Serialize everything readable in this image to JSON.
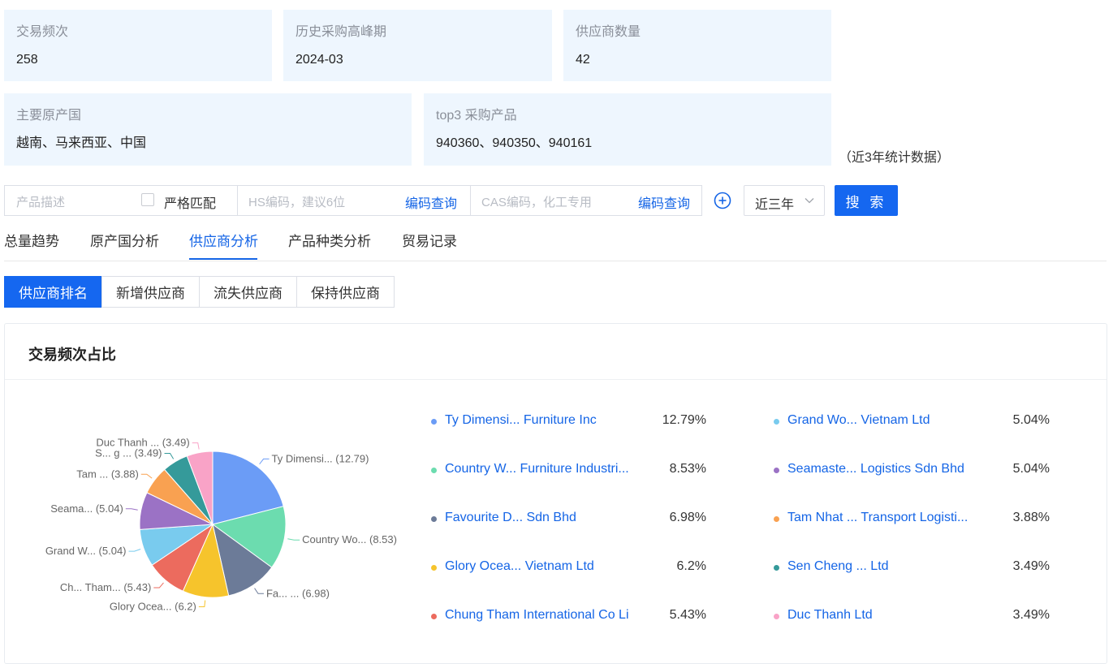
{
  "stats": [
    {
      "label": "交易频次",
      "value": "258"
    },
    {
      "label": "历史采购高峰期",
      "value": "2024-03"
    },
    {
      "label": "供应商数量",
      "value": "42"
    },
    {
      "label": "主要原产国",
      "value": "越南、马来西亚、中国"
    },
    {
      "label": "top3 采购产品",
      "value": "940360、940350、940161"
    }
  ],
  "stats_note": "（近3年统计数据）",
  "search": {
    "product_placeholder": "产品描述",
    "strict_label": "严格匹配",
    "hs_placeholder": "HS编码，建议6位",
    "hs_link": "编码查询",
    "cas_placeholder": "CAS编码，化工专用",
    "cas_link": "编码查询",
    "range_value": "近三年",
    "search_button": "搜 索"
  },
  "tabs": [
    "总量趋势",
    "原产国分析",
    "供应商分析",
    "产品种类分析",
    "贸易记录"
  ],
  "active_tab": 2,
  "subtabs": [
    "供应商排名",
    "新增供应商",
    "流失供应商",
    "保持供应商"
  ],
  "active_subtab": 0,
  "panel_title": "交易频次占比",
  "chart_data": {
    "type": "pie",
    "title": "交易频次占比",
    "slices": [
      {
        "name": "Ty Dimensi... Furniture Inc",
        "label": "Ty Dimensi... (12.79)",
        "value": 12.79,
        "color": "#6b9cf6",
        "pct": "12.79%"
      },
      {
        "name": "Country W... Furniture Industri...",
        "label": "Country Wo... (8.53)",
        "value": 8.53,
        "color": "#6cdcaf",
        "pct": "8.53%"
      },
      {
        "name": "Favourite D... Sdn Bhd",
        "label": "Fa... ... (6.98)",
        "value": 6.98,
        "color": "#6c7b98",
        "pct": "6.98%"
      },
      {
        "name": "Glory Ocea... Vietnam Ltd",
        "label": "Glory Ocea... (6.2)",
        "value": 6.2,
        "color": "#f6c42c",
        "pct": "6.2%"
      },
      {
        "name": "Chung Tham International Co Li",
        "label": "Ch... Tham... (5.43)",
        "value": 5.43,
        "color": "#ec6b5e",
        "pct": "5.43%"
      },
      {
        "name": "Grand Wo... Vietnam Ltd",
        "label": "Grand W... (5.04)",
        "value": 5.04,
        "color": "#79cbee",
        "pct": "5.04%"
      },
      {
        "name": "Seamaste... Logistics Sdn Bhd",
        "label": "Seama... (5.04)",
        "value": 5.04,
        "color": "#9b72c5",
        "pct": "5.04%"
      },
      {
        "name": "Tam Nhat ... Transport Logisti...",
        "label": "Tam ... (3.88)",
        "value": 3.88,
        "color": "#f9a151",
        "pct": "3.88%"
      },
      {
        "name": "Sen Cheng ... Ltd",
        "label": "S... g ... (3.49)",
        "value": 3.49,
        "color": "#359a9a",
        "pct": "3.49%"
      },
      {
        "name": "Duc Thanh Ltd",
        "label": "Duc Thanh ... (3.49)",
        "value": 3.49,
        "color": "#f9a3c7",
        "pct": "3.49%"
      }
    ]
  }
}
